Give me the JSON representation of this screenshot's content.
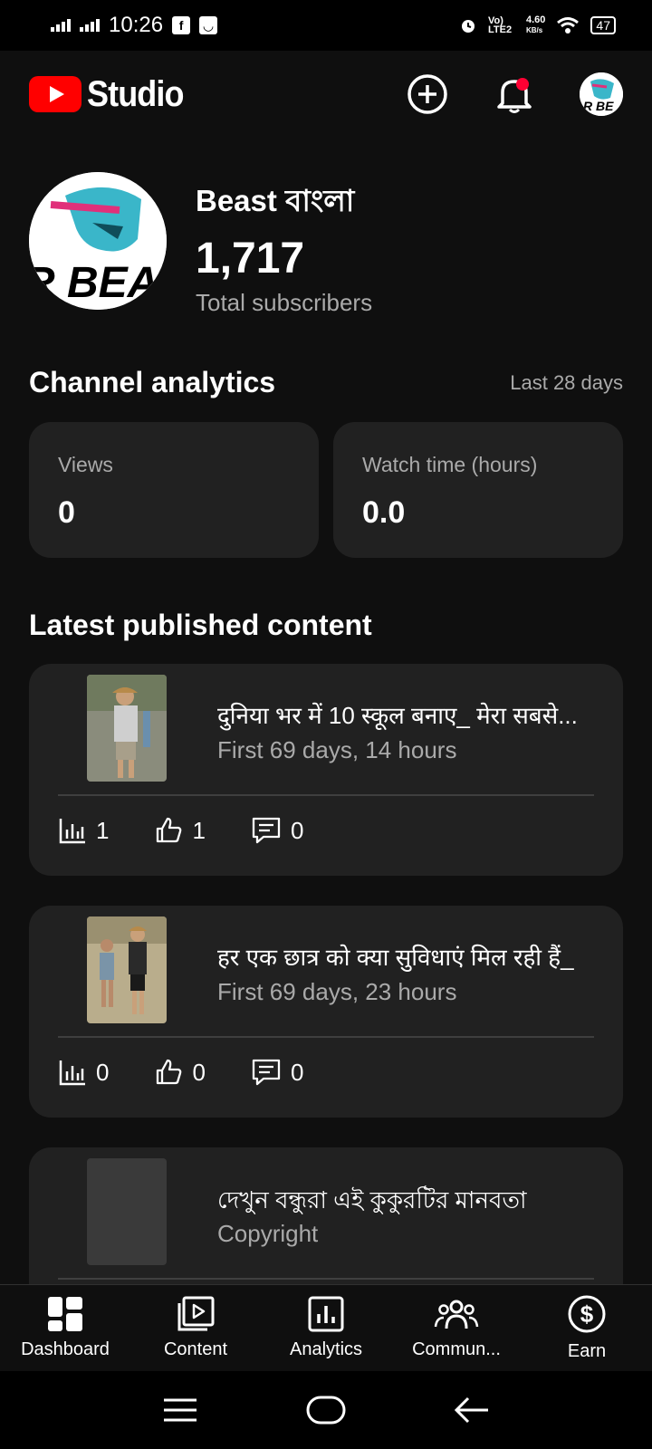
{
  "status_bar": {
    "time": "10:26",
    "facebook_icon": "facebook-icon",
    "shopping_icon": "bag-icon",
    "volte_label": "Vo) LTE2",
    "speed_value": "4.60",
    "speed_unit": "KB/s",
    "battery": "47"
  },
  "app_bar": {
    "brand": "Studio",
    "icons": [
      "create-icon",
      "bell-icon",
      "account-avatar"
    ],
    "notification_dot_color": "#ff0033"
  },
  "channel": {
    "name": "Beast বাংলা",
    "subscribers": "1,717",
    "subscribers_label": "Total subscribers"
  },
  "analytics": {
    "title": "Channel analytics",
    "range": "Last 28 days",
    "cards": [
      {
        "label": "Views",
        "value": "0"
      },
      {
        "label": "Watch time (hours)",
        "value": "0.0"
      }
    ]
  },
  "latest": {
    "title": "Latest published content",
    "items": [
      {
        "title": "दुनिया भर में 10 स्कूल बनाए_ मेरा सबसे...",
        "meta": "First 69 days, 14 hours",
        "views": "1",
        "likes": "1",
        "comments": "0"
      },
      {
        "title": "हर एक छात्र को क्या सुविधाएं मिल रही हैं_",
        "meta": "First 69 days, 23 hours",
        "views": "0",
        "likes": "0",
        "comments": "0"
      },
      {
        "title": "দেখুন বন্ধুরা এই কুকুরটির মানবতা",
        "meta": "Copyright"
      }
    ]
  },
  "bottom_nav": [
    {
      "label": "Dashboard",
      "icon": "dashboard-icon"
    },
    {
      "label": "Content",
      "icon": "content-icon"
    },
    {
      "label": "Analytics",
      "icon": "analytics-icon"
    },
    {
      "label": "Commun...",
      "icon": "community-icon"
    },
    {
      "label": "Earn",
      "icon": "earn-icon"
    }
  ],
  "colors": {
    "background": "#0f0f0f",
    "card": "#212121",
    "accent_red": "#ff0000",
    "secondary_text": "#aaaaaa"
  }
}
